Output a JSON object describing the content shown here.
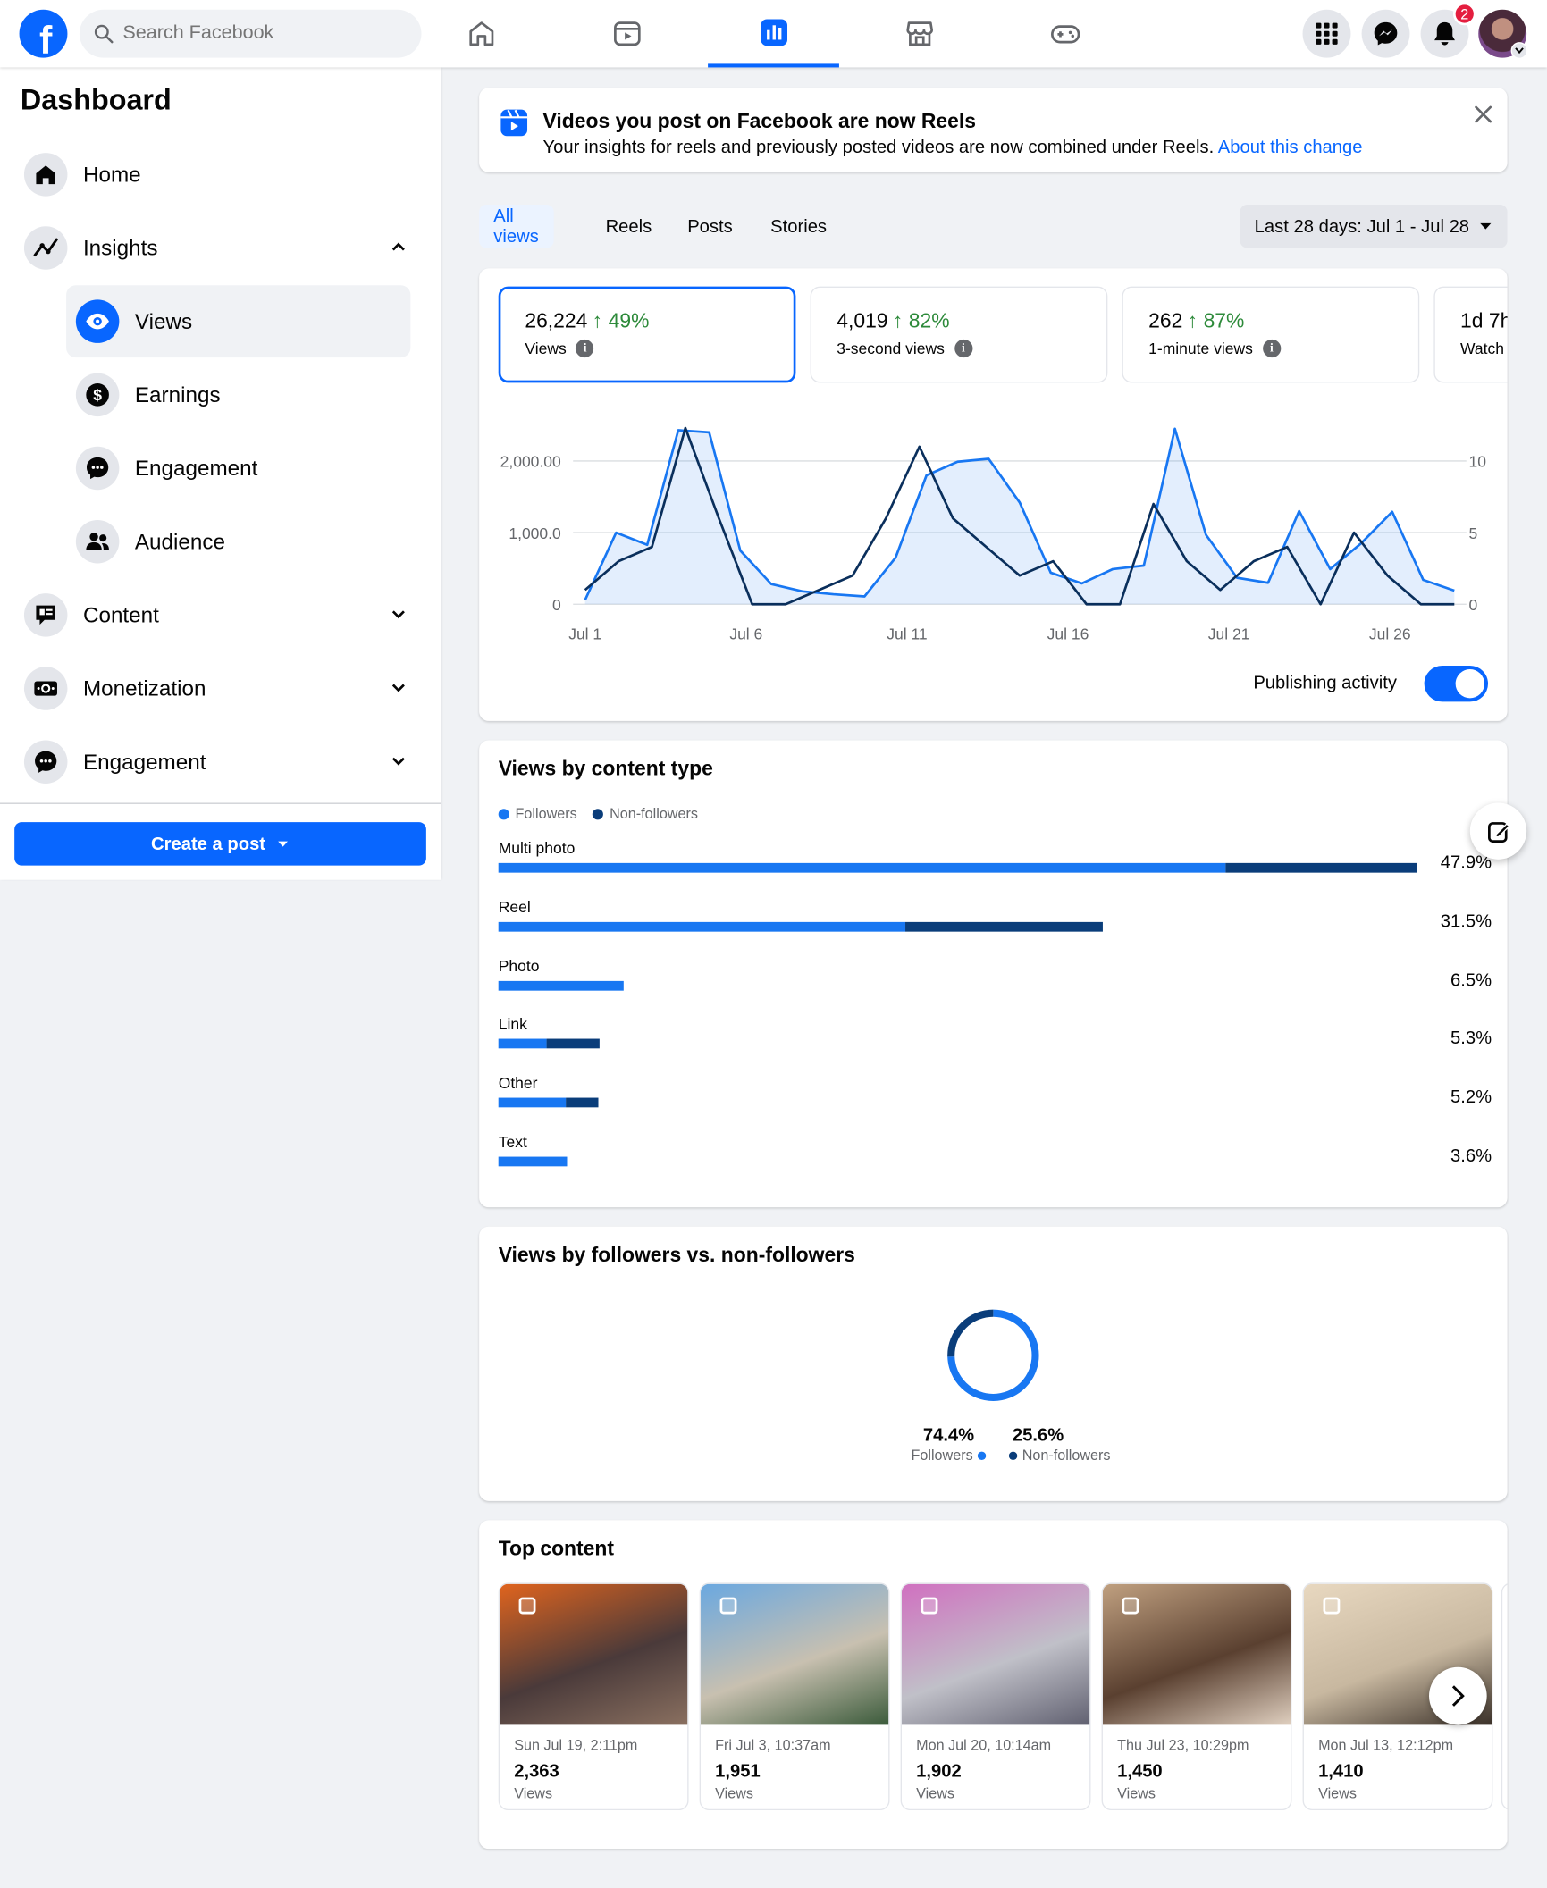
{
  "topbar": {
    "logo_letter": "f",
    "search_placeholder": "Search Facebook",
    "nav_tabs": [
      "home-icon",
      "video-icon",
      "dashboard-icon",
      "marketplace-icon",
      "gaming-icon"
    ],
    "active_tab": "dashboard-icon",
    "notifications_count": "2"
  },
  "sidebar": {
    "title": "Dashboard",
    "home": "Home",
    "insights": "Insights",
    "insights_sub": {
      "views": "Views",
      "earnings": "Earnings",
      "engagement": "Engagement",
      "audience": "Audience"
    },
    "content": "Content",
    "monetization": "Monetization",
    "engagement": "Engagement",
    "create_post": "Create a post"
  },
  "banner": {
    "title": "Videos you post on Facebook are now Reels",
    "text": "Your insights for reels and previously posted videos are now combined under Reels. ",
    "link": "About this change"
  },
  "tabs": [
    "All views",
    "Reels",
    "Posts",
    "Stories"
  ],
  "date_range": "Last 28 days: Jul 1 - Jul 28",
  "metrics": [
    {
      "value": "26,224",
      "change": "49%",
      "label": "Views"
    },
    {
      "value": "4,019",
      "change": "82%",
      "label": "3-second views"
    },
    {
      "value": "262",
      "change": "87%",
      "label": "1-minute views"
    },
    {
      "value": "1d 7h",
      "label": "Watch"
    }
  ],
  "publishing_activity_label": "Publishing activity",
  "publishing_activity_on": true,
  "colors": {
    "accent": "#0866ff",
    "followers": "#1877f2",
    "non_followers": "#0a3d7a",
    "positive": "#2d8a3a"
  },
  "chart_data": [
    {
      "type": "line",
      "x": [
        "Jul 1",
        "Jul 2",
        "Jul 3",
        "Jul 4",
        "Jul 5",
        "Jul 6",
        "Jul 7",
        "Jul 8",
        "Jul 9",
        "Jul 10",
        "Jul 11",
        "Jul 12",
        "Jul 13",
        "Jul 14",
        "Jul 15",
        "Jul 16",
        "Jul 17",
        "Jul 18",
        "Jul 19",
        "Jul 20",
        "Jul 21",
        "Jul 22",
        "Jul 23",
        "Jul 24",
        "Jul 25",
        "Jul 26",
        "Jul 27",
        "Jul 28"
      ],
      "x_ticks": [
        "Jul 1",
        "Jul 6",
        "Jul 11",
        "Jul 16",
        "Jul 21",
        "Jul 26"
      ],
      "y_ticks_left": [
        "2,000.00",
        "1,000.0",
        "0"
      ],
      "y_ticks_right": [
        "10",
        "5",
        "0"
      ],
      "ylim_left": [
        0,
        2000
      ],
      "ylim_right": [
        0,
        10
      ],
      "series": [
        {
          "axis": "left",
          "style": "area",
          "values": [
            60,
            1000,
            830,
            2430,
            2400,
            750,
            280,
            180,
            140,
            110,
            650,
            1800,
            1990,
            2030,
            1420,
            440,
            290,
            490,
            540,
            2450,
            970,
            370,
            300,
            1300,
            490,
            850,
            1290,
            340,
            190
          ]
        },
        {
          "axis": "right",
          "style": "line",
          "values": [
            1,
            3,
            4,
            12.3,
            6,
            0,
            0,
            1,
            2,
            6,
            11,
            6,
            4,
            2,
            3,
            0,
            0,
            7,
            3,
            1,
            3,
            4,
            0,
            5,
            2,
            0,
            0
          ]
        }
      ]
    },
    {
      "type": "bar",
      "title": "Views by content type",
      "stacked": true,
      "categories": [
        "Multi photo",
        "Reel",
        "Photo",
        "Link",
        "Other",
        "Text"
      ],
      "totals_pct": [
        "47.9%",
        "31.5%",
        "6.5%",
        "5.3%",
        "5.2%",
        "3.6%"
      ],
      "series": [
        {
          "name": "Followers",
          "values": [
            37.9,
            21.2,
            6.5,
            2.5,
            3.5,
            3.6
          ]
        },
        {
          "name": "Non-followers",
          "values": [
            10.0,
            10.3,
            0,
            2.8,
            1.7,
            0
          ]
        }
      ]
    },
    {
      "type": "pie",
      "title": "Views by followers vs. non-followers",
      "labels": [
        "Followers",
        "Non-followers"
      ],
      "values": [
        74.4,
        25.6
      ],
      "display": [
        "74.4%",
        "25.6%"
      ]
    }
  ],
  "top_content": {
    "title": "Top content",
    "items": [
      {
        "date": "Sun Jul 19, 2:11pm",
        "views": "2,363",
        "label": "Views",
        "palette": [
          "#e0641e",
          "#4a3a3a",
          "#8a7060"
        ]
      },
      {
        "date": "Fri Jul 3, 10:37am",
        "views": "1,951",
        "label": "Views",
        "palette": [
          "#6aa8e0",
          "#c8c0b0",
          "#3a5a3a"
        ]
      },
      {
        "date": "Mon Jul 20, 10:14am",
        "views": "1,902",
        "label": "Views",
        "palette": [
          "#d070c0",
          "#c0c0c8",
          "#606070"
        ]
      },
      {
        "date": "Thu Jul 23, 10:29pm",
        "views": "1,450",
        "label": "Views",
        "palette": [
          "#c0a080",
          "#5a4030",
          "#e0d0c0"
        ]
      },
      {
        "date": "Mon Jul 13, 12:12pm",
        "views": "1,410",
        "label": "Views",
        "palette": [
          "#e8d8c0",
          "#c8b8a0",
          "#3a3028"
        ]
      }
    ]
  }
}
